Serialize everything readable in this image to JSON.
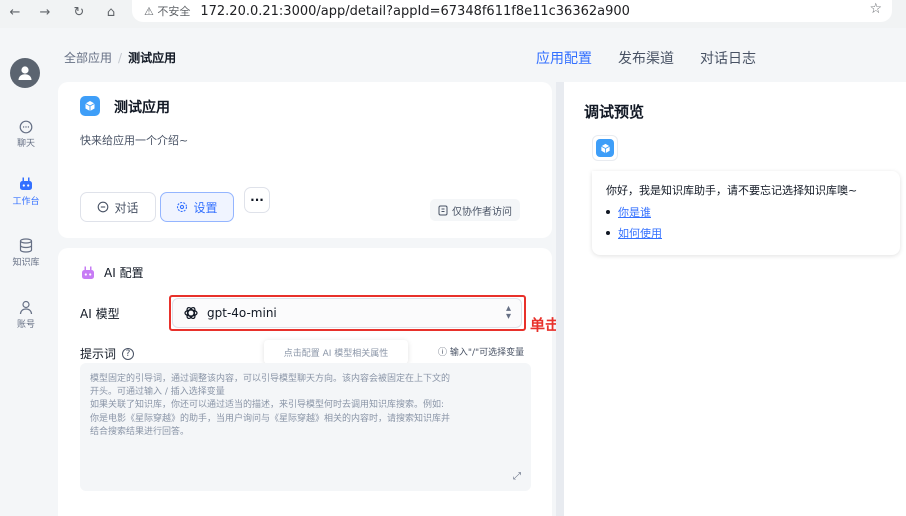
{
  "browser": {
    "back": "←",
    "forward": "→",
    "reload": "↻",
    "home": "⌂",
    "insecure": "⚠ 不安全",
    "url": "172.20.0.21:3000/app/detail?appId=67348f611f8e11c36362a900",
    "bookmark": "☆"
  },
  "nav": {
    "items": [
      {
        "label": "聊天",
        "icon": "chat-bubble-icon"
      },
      {
        "label": "工作台",
        "icon": "robot-icon"
      },
      {
        "label": "知识库",
        "icon": "database-icon"
      },
      {
        "label": "账号",
        "icon": "user-icon"
      }
    ]
  },
  "breadcrumb": {
    "root": "全部应用",
    "current": "测试应用"
  },
  "tabs": [
    "应用配置",
    "发布渠道",
    "对话日志"
  ],
  "app": {
    "name": "测试应用",
    "intro": "快来给应用一个介绍~",
    "chat_label": "对话",
    "settings_label": "设置",
    "more_label": "···",
    "access_label": "仅协作者访问"
  },
  "ai_config": {
    "title": "AI 配置",
    "model_label": "AI 模型",
    "model_value": "gpt-4o-mini",
    "prompt_label": "提示词",
    "tooltip": "点击配置 AI 模型相关属性",
    "variable_hint": "输入\"/\"可选择变量",
    "prompt_placeholder_lines": [
      "模型固定的引导词，通过调整该内容，可以引导模型聊天方向。该内容会被固定在上下文的",
      "开头。可通过输入 / 插入选择变量",
      "如果关联了知识库，你还可以通过适当的描述，来引导模型何时去调用知识库搜索。例如:",
      "你是电影《星际穿越》的助手，当用户询问与《星际穿越》相关的内容时，请搜索知识库并",
      "结合搜索结果进行回答。"
    ]
  },
  "annotation": {
    "click": "单击",
    "color": "#e8312b"
  },
  "preview": {
    "title": "调试预览",
    "welcome": "你好，我是知识库助手，请不要忘记选择知识库噢~",
    "links": [
      "你是谁",
      "如何使用"
    ]
  },
  "colors": {
    "accent": "#3370ff",
    "app_icon": "#3e9ef8",
    "highlight": "#e8312b"
  }
}
